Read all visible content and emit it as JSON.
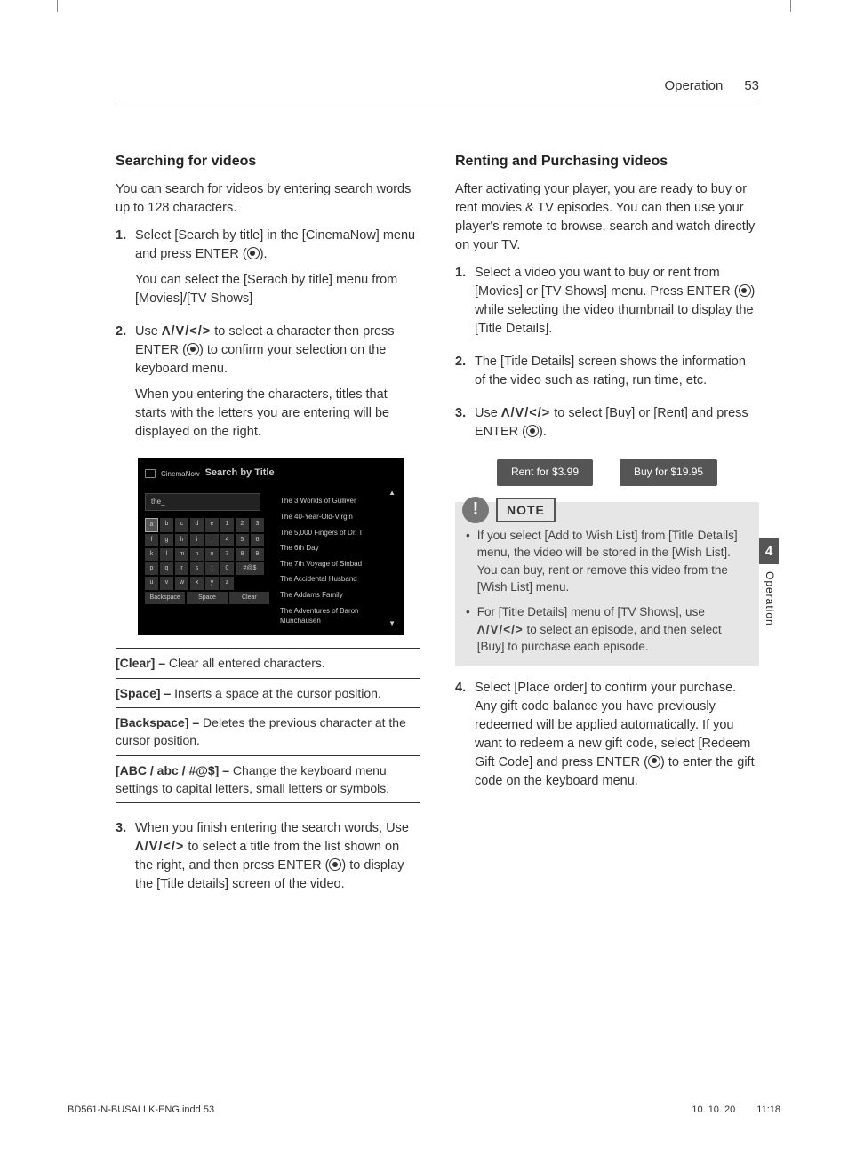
{
  "header": {
    "section": "Operation",
    "page": "53"
  },
  "sideTab": {
    "num": "4",
    "label": "Operation"
  },
  "left": {
    "heading": "Searching for videos",
    "intro": "You can search for videos by entering search words up to 128 characters.",
    "step1": {
      "p1a": "Select [Search by title] in the [CinemaNow] menu and press ENTER (",
      "p1b": ").",
      "p2": "You can select the [Serach by title] menu from [Movies]/[TV Shows]"
    },
    "step2": {
      "p1a": "Use ",
      "arrows": "Λ/V/</>",
      "p1b": " to select a character then press ENTER (",
      "p1c": ") to confirm your selection on the keyboard menu.",
      "p2": "When you entering the characters, titles that starts with the letters you are entering will be displayed on the right."
    },
    "screenshot": {
      "brand": "CinemaNow",
      "title": "Search by Title",
      "searchText": "the_",
      "keys": [
        "a",
        "b",
        "c",
        "d",
        "e",
        "1",
        "2",
        "3",
        "f",
        "g",
        "h",
        "i",
        "j",
        "4",
        "5",
        "6",
        "k",
        "l",
        "m",
        "n",
        "o",
        "7",
        "8",
        "9",
        "p",
        "q",
        "r",
        "s",
        "t",
        "0"
      ],
      "etc": "#@$",
      "keysRow4": [
        "u",
        "v",
        "w",
        "x",
        "y",
        "z"
      ],
      "bottom": [
        "Backspace",
        "Space",
        "Clear"
      ],
      "results": [
        "The 3 Worlds of Gulliver",
        "The 40-Year-Old-Virgin",
        "The 5,000 Fingers of Dr. T",
        "The 6th Day",
        "The 7th Voyage of Sinbad",
        "The Accidental Husband",
        "The Addams Family",
        "The Adventures of Baron Munchausen"
      ]
    },
    "defs": [
      {
        "term": "[Clear] –",
        "desc": " Clear all entered characters."
      },
      {
        "term": "[Space] –",
        "desc": " Inserts a space at the cursor position."
      },
      {
        "term": "[Backspace] –",
        "desc": " Deletes the previous character at the cursor position."
      },
      {
        "term": "[ABC / abc / #@$] –",
        "desc": " Change the keyboard menu settings to capital letters, small letters or symbols."
      }
    ],
    "step3": {
      "p1a": "When you finish entering the search words, Use ",
      "arrows": "Λ/V/</>",
      "p1b": " to select a title from the list shown on the right, and then press ENTER (",
      "p1c": ") to display the [Title details] screen of the video."
    }
  },
  "right": {
    "heading": "Renting and Purchasing videos",
    "intro": "After activating your player, you are ready to buy or rent movies & TV episodes. You can then use your player's remote to browse, search and watch directly on your TV.",
    "step1": {
      "p1a": "Select a video you want to buy or rent from [Movies] or [TV Shows] menu. Press ENTER (",
      "p1b": ") while selecting the video thumbnail to display the [Title Details]."
    },
    "step2": "The [Title Details] screen shows the information of the video such as rating, run time, etc.",
    "step3": {
      "p1a": "Use ",
      "arrows": "Λ/V/</>",
      "p1b": " to select [Buy] or [Rent] and press ENTER (",
      "p1c": ")."
    },
    "buttons": {
      "rent": "Rent for $3.99",
      "buy": "Buy for $19.95"
    },
    "note": {
      "label": "NOTE",
      "item1": "If you select [Add to Wish List] from [Title Details] menu, the video will be stored in the [Wish List]. You can buy, rent or remove this video from the [Wish List] menu.",
      "item2a": "For [Title Details] menu of [TV Shows], use ",
      "item2arrows": "Λ/V/</>",
      "item2b": " to select an episode, and then select [Buy] to purchase each episode."
    },
    "step4": {
      "p1a": "Select [Place order] to confirm your purchase. Any gift code balance you have previously redeemed will be applied automatically. If you want to redeem a new gift code, select [Redeem Gift Code] and press ENTER (",
      "p1b": ") to enter the gift code on the keyboard menu."
    }
  },
  "footer": {
    "file": "BD561-N-BUSALLK-ENG.indd   53",
    "date": "10. 10. 20",
    "time": "11:18"
  }
}
